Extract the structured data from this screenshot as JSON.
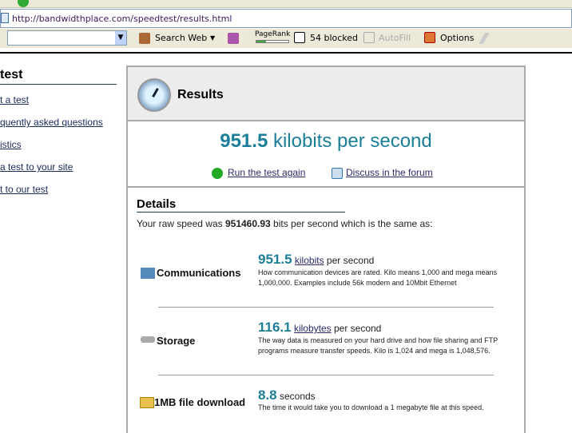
{
  "browser": {
    "url": "http://bandwidthplace.com/speedtest/results.html"
  },
  "toolbar": {
    "search_label": "Search Web",
    "pagerank_label": "PageRank",
    "pagerank_fraction": 0.3,
    "blocked_label": "54 blocked",
    "autofill_label": "AutoFill",
    "options_label": "Options"
  },
  "sidebar": {
    "heading": "test",
    "links": [
      "t a test",
      "quently asked questions",
      "istics",
      "a test to your site",
      "t to our test"
    ]
  },
  "results": {
    "title": "Results",
    "speed_value": "951.5",
    "speed_unit": "kilobits per second",
    "run_again": "Run the test again",
    "discuss": "Discuss in the forum"
  },
  "details": {
    "heading": "Details",
    "raw_prefix": "Your raw speed was",
    "raw_value": "951460.93",
    "raw_suffix": "bits per second which is the same as:",
    "rows": [
      {
        "label": "Communications",
        "value": "951.5",
        "unit": "kilobits",
        "suffix": "per second",
        "desc": "How communication devices are rated. Kilo means 1,000 and mega means 1,000,000. Examples include 56k modem and 10Mbit Ethernet"
      },
      {
        "label": "Storage",
        "value": "116.1",
        "unit": "kilobytes",
        "suffix": "per second",
        "desc": "The way data is measured on your hard drive and how file sharing and FTP programs measure transfer speeds. Kilo is 1,024 and mega is 1,048,576."
      },
      {
        "label": "1MB file download",
        "value": "8.8",
        "suffix": "seconds",
        "desc": "The time it would take you to download a 1 megabyte file at this speed."
      }
    ]
  },
  "colors": {
    "accent": "#1b7f99",
    "panel_border": "#aaaaaa",
    "header_bg": "#ececec"
  }
}
